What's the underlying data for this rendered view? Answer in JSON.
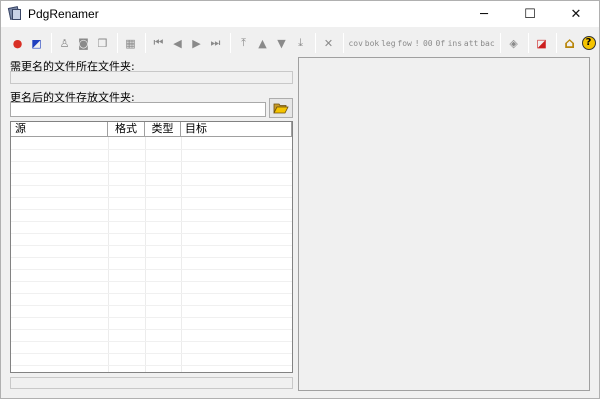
{
  "window": {
    "title": "PdgRenamer",
    "controls": {
      "minimize": "─",
      "maximize": "☐",
      "close": "✕"
    }
  },
  "toolbar": {
    "items": [
      {
        "id": "color-wheel",
        "icon": "color-wheel-icon",
        "glyph": "●",
        "color": "#d93025"
      },
      {
        "id": "chart",
        "icon": "chart-icon",
        "glyph": "◩",
        "color": "#1f3fbf"
      },
      {
        "sep": true
      },
      {
        "id": "user",
        "icon": "user-icon",
        "glyph": "♙"
      },
      {
        "id": "camera",
        "icon": "camera-icon",
        "glyph": "◙"
      },
      {
        "id": "book",
        "icon": "book-icon",
        "glyph": "❒"
      },
      {
        "sep": true
      },
      {
        "id": "bookmark",
        "icon": "bookmark-icon",
        "glyph": "▦"
      },
      {
        "sep": true
      },
      {
        "id": "first",
        "icon": "first-icon",
        "glyph": "⏮"
      },
      {
        "id": "prev",
        "icon": "prev-icon",
        "glyph": "◀"
      },
      {
        "id": "next",
        "icon": "next-icon",
        "glyph": "▶"
      },
      {
        "id": "last",
        "icon": "last-icon",
        "glyph": "⏭"
      },
      {
        "sep": true
      },
      {
        "id": "move-top",
        "icon": "move-top-icon",
        "glyph": "⤒"
      },
      {
        "id": "move-up",
        "icon": "move-up-icon",
        "glyph": "▲"
      },
      {
        "id": "move-down",
        "icon": "move-down-icon",
        "glyph": "▼"
      },
      {
        "id": "move-bottom",
        "icon": "move-bottom-icon",
        "glyph": "⤓"
      },
      {
        "sep": true
      },
      {
        "id": "delete",
        "icon": "delete-icon",
        "glyph": "✕"
      },
      {
        "sep": true
      },
      {
        "id": "cov",
        "text": "cov"
      },
      {
        "id": "bok",
        "text": "bok"
      },
      {
        "id": "leg",
        "text": "leg"
      },
      {
        "id": "fow",
        "text": "fow"
      },
      {
        "id": "excl",
        "text": "!"
      },
      {
        "id": "zero",
        "text": "00"
      },
      {
        "id": "zerof",
        "text": "0f"
      },
      {
        "id": "ins",
        "text": "ins"
      },
      {
        "id": "att",
        "text": "att"
      },
      {
        "id": "bac",
        "text": "bac"
      },
      {
        "sep": true
      },
      {
        "id": "eraser",
        "icon": "eraser-icon",
        "glyph": "◈"
      },
      {
        "sep": true
      },
      {
        "id": "rename",
        "icon": "rename-icon",
        "glyph": "◪",
        "color": "#cc1f1f"
      },
      {
        "sep": true
      },
      {
        "id": "home",
        "icon": "home-icon",
        "glyph": "⌂",
        "color": "#b8860b"
      },
      {
        "id": "help",
        "icon": "help-icon",
        "glyph": "?",
        "color": "#000000"
      }
    ]
  },
  "source": {
    "label": "需更名的文件所在文件夹:",
    "value": ""
  },
  "dest": {
    "label": "更名后的文件存放文件夹:",
    "value": ""
  },
  "list": {
    "columns": {
      "source": "源",
      "format": "格式",
      "type": "类型",
      "target": "目标"
    },
    "rows": []
  },
  "colors": {
    "accent": "#d93025",
    "gold": "#f5c400",
    "frame": "#a0a0a0"
  }
}
